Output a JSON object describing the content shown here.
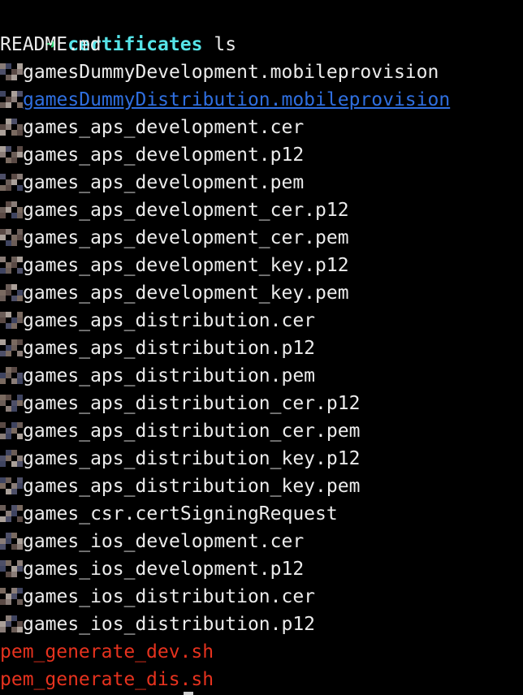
{
  "terminal": {
    "prompt": {
      "arrow": "➜",
      "cwd": "certificates",
      "command": "ls"
    },
    "files": [
      {
        "name": "README.md",
        "kind": "plain"
      },
      {
        "name": "gamesDummyDevelopment.mobileprovision",
        "kind": "plain"
      },
      {
        "name": "gamesDummyDistribution.mobileprovision",
        "kind": "link"
      },
      {
        "name": "games_aps_development.cer",
        "kind": "plain"
      },
      {
        "name": "games_aps_development.p12",
        "kind": "plain"
      },
      {
        "name": "games_aps_development.pem",
        "kind": "plain"
      },
      {
        "name": "games_aps_development_cer.p12",
        "kind": "plain"
      },
      {
        "name": "games_aps_development_cer.pem",
        "kind": "plain"
      },
      {
        "name": "games_aps_development_key.p12",
        "kind": "plain"
      },
      {
        "name": "games_aps_development_key.pem",
        "kind": "plain"
      },
      {
        "name": "games_aps_distribution.cer",
        "kind": "plain"
      },
      {
        "name": "games_aps_distribution.p12",
        "kind": "plain"
      },
      {
        "name": "games_aps_distribution.pem",
        "kind": "plain"
      },
      {
        "name": "games_aps_distribution_cer.p12",
        "kind": "plain"
      },
      {
        "name": "games_aps_distribution_cer.pem",
        "kind": "plain"
      },
      {
        "name": "games_aps_distribution_key.p12",
        "kind": "plain"
      },
      {
        "name": "games_aps_distribution_key.pem",
        "kind": "plain"
      },
      {
        "name": "games_csr.certSigningRequest",
        "kind": "plain"
      },
      {
        "name": "games_ios_development.cer",
        "kind": "plain"
      },
      {
        "name": "games_ios_development.p12",
        "kind": "plain"
      },
      {
        "name": "games_ios_distribution.cer",
        "kind": "plain"
      },
      {
        "name": "games_ios_distribution.p12",
        "kind": "plain"
      },
      {
        "name": "pem_generate_dev.sh",
        "kind": "exec"
      },
      {
        "name": "pem_generate_dis.sh",
        "kind": "exec"
      }
    ],
    "colors": {
      "background": "#000000",
      "text": "#ececec",
      "prompt_arrow": "#2fe07a",
      "cwd": "#56e4e8",
      "link": "#2f6fe0",
      "executable": "#e6321e"
    }
  }
}
